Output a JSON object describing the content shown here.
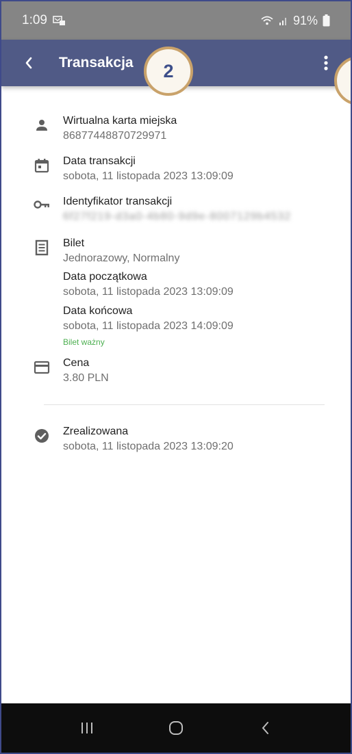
{
  "status_bar": {
    "time": "1:09",
    "battery": "91%"
  },
  "app_bar": {
    "title": "Transakcja"
  },
  "badge": {
    "number": "2"
  },
  "items": {
    "card_label": "Wirtualna karta miejska",
    "card_value": "86877448870729971",
    "date_label": "Data transakcji",
    "date_value": "sobota, 11 listopada 2023 13:09:09",
    "id_label": "Identyfikator transakcji",
    "id_value": "6f27f219-d3a0-4b80-9d9e-8007129b4532",
    "ticket_label": "Bilet",
    "ticket_value": "Jednorazowy, Normalny",
    "start_label": "Data początkowa",
    "start_value": "sobota, 11 listopada 2023 13:09:09",
    "end_label": "Data końcowa",
    "end_value": "sobota, 11 listopada 2023 14:09:09",
    "valid_text": "Bilet ważny",
    "price_label": "Cena",
    "price_value": "3.80 PLN",
    "status_label": "Zrealizowana",
    "status_value": "sobota, 11 listopada 2023 13:09:20"
  },
  "icons": {
    "card": "person-icon",
    "date": "calendar-icon",
    "id": "key-icon",
    "ticket": "receipt-icon",
    "price": "credit-card-icon",
    "status": "check-circle-icon"
  },
  "colors": {
    "app_bar": "#505a86",
    "status_bar": "#858585",
    "valid": "#4caf50",
    "badge_border": "#c9a26a"
  }
}
